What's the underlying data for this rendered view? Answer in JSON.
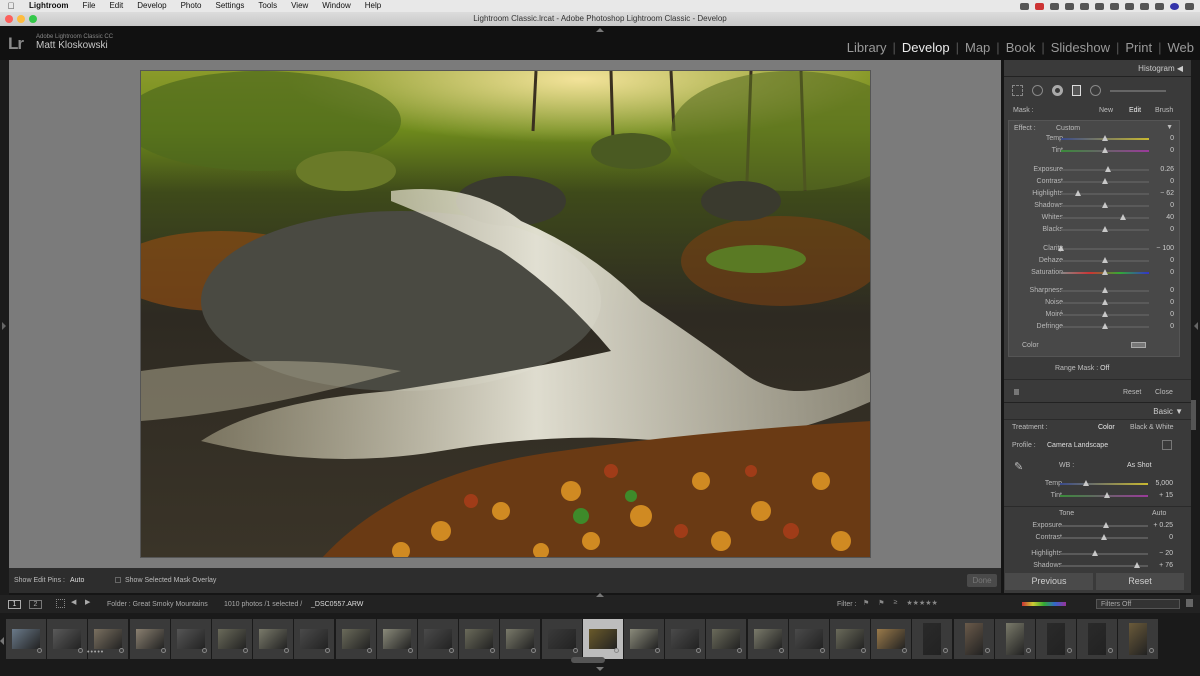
{
  "menubar": {
    "app_name": "Lightroom",
    "menus": [
      "File",
      "Edit",
      "Develop",
      "Photo",
      "Settings",
      "Tools",
      "View",
      "Window",
      "Help"
    ]
  },
  "window": {
    "title": "Lightroom Classic.lrcat - Adobe Photoshop Lightroom Classic - Develop"
  },
  "identity": {
    "logo": "Lr",
    "product": "Adobe Lightroom Classic CC",
    "user": "Matt Kloskowski"
  },
  "modules": {
    "items": [
      "Library",
      "Develop",
      "Map",
      "Book",
      "Slideshow",
      "Print",
      "Web"
    ],
    "active": "Develop"
  },
  "toolbar": {
    "edit_pins_label": "Show Edit Pins :",
    "edit_pins_value": "Auto",
    "mask_overlay_label": "Show Selected Mask Overlay",
    "done_label": "Done"
  },
  "panel": {
    "histogram_label": "Histogram",
    "mask_label": "Mask :",
    "mask_new": "New",
    "mask_edit": "Edit",
    "mask_brush": "Brush",
    "effect_label": "Effect :",
    "effect_value": "Custom",
    "sliders": [
      {
        "label": "Temp",
        "value": "0",
        "pos": 0.5,
        "grad": "temp"
      },
      {
        "label": "Tint",
        "value": "0",
        "pos": 0.5,
        "grad": "tint"
      },
      {
        "label": "Exposure",
        "value": "0.26",
        "pos": 0.53
      },
      {
        "label": "Contrast",
        "value": "0",
        "pos": 0.5
      },
      {
        "label": "Highlights",
        "value": "− 62",
        "pos": 0.19
      },
      {
        "label": "Shadows",
        "value": "0",
        "pos": 0.5
      },
      {
        "label": "Whites",
        "value": "40",
        "pos": 0.7
      },
      {
        "label": "Blacks",
        "value": "0",
        "pos": 0.5
      },
      {
        "label": "Clarity",
        "value": "− 100",
        "pos": 0.0
      },
      {
        "label": "Dehaze",
        "value": "0",
        "pos": 0.5
      },
      {
        "label": "Saturation",
        "value": "0",
        "pos": 0.5,
        "grad": "sat"
      },
      {
        "label": "Sharpness",
        "value": "0",
        "pos": 0.5
      },
      {
        "label": "Noise",
        "value": "0",
        "pos": 0.5
      },
      {
        "label": "Moiré",
        "value": "0",
        "pos": 0.5
      },
      {
        "label": "Defringe",
        "value": "0",
        "pos": 0.5
      }
    ],
    "color_label": "Color",
    "range_mask_label": "Range Mask :",
    "range_mask_value": "Off",
    "reset_label": "Reset",
    "close_label": "Close",
    "basic_label": "Basic",
    "treatment_label": "Treatment :",
    "treatment_color": "Color",
    "treatment_bw": "Black & White",
    "profile_label": "Profile :",
    "profile_value": "Camera Landscape",
    "wb_label": "WB :",
    "wb_value": "As Shot",
    "basic_sliders": [
      {
        "label": "Temp",
        "value": "5,000",
        "pos": 0.3,
        "grad": "temp"
      },
      {
        "label": "Tint",
        "value": "+ 15",
        "pos": 0.53,
        "grad": "tint"
      },
      {
        "label": "Exposure",
        "value": "+ 0.25",
        "pos": 0.52
      },
      {
        "label": "Contrast",
        "value": "0",
        "pos": 0.5
      },
      {
        "label": "Highlights",
        "value": "− 20",
        "pos": 0.4
      },
      {
        "label": "Shadows",
        "value": "+ 76",
        "pos": 0.88
      }
    ],
    "tone_label": "Tone",
    "auto_label": "Auto",
    "previous_label": "Previous",
    "reset_button_label": "Reset"
  },
  "filmbar": {
    "view_1": "1",
    "view_2": "2",
    "source": "Folder : Great Smoky Mountains",
    "count": "1010 photos /1 selected /",
    "filename": "_DSC0557.ARW",
    "filter_label": "Filter :",
    "filter_value": "Filters Off"
  },
  "filmstrip": {
    "thumbnails": 28,
    "selected_index": 14
  }
}
